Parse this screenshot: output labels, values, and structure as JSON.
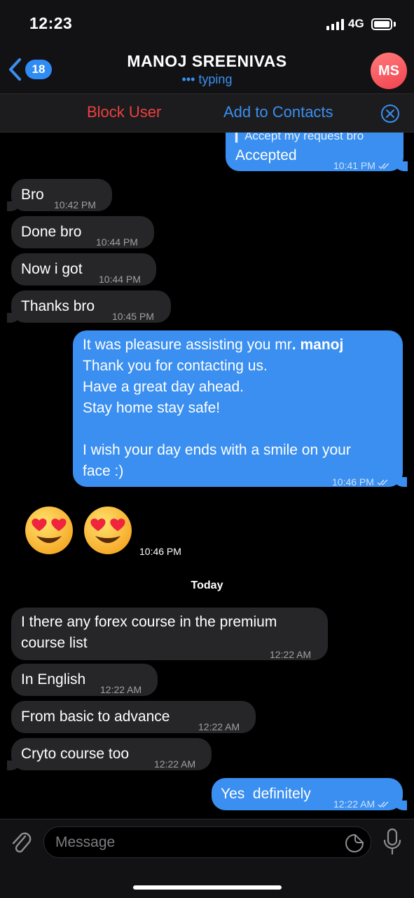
{
  "status_bar": {
    "time": "12:23",
    "network": "4G"
  },
  "header": {
    "back_badge": "18",
    "title": "MANOJ SREENIVAS",
    "status": "••• typing",
    "avatar_initials": "MS"
  },
  "action_bar": {
    "block_label": "Block User",
    "add_label": "Add to Contacts"
  },
  "messages": [
    {
      "dir": "out",
      "reply_preview": "Accept my request bro",
      "text": "Accepted",
      "time": "10:41 PM"
    },
    {
      "dir": "in",
      "text": "Bro",
      "time": "10:42 PM"
    },
    {
      "dir": "in",
      "text": "Done bro",
      "time": "10:44 PM"
    },
    {
      "dir": "in",
      "text": "Now i got",
      "time": "10:44 PM"
    },
    {
      "dir": "in",
      "text": "Thanks bro",
      "time": "10:45 PM"
    },
    {
      "dir": "out",
      "lines": [
        "It was pleasure assisting you mr",
        ". manoj",
        "Thank you for contacting us.",
        "Have a great day ahead.",
        "Stay home stay safe!",
        "I wish your day ends with a smile on your",
        "face :)"
      ],
      "time": "10:46 PM"
    },
    {
      "dir": "in",
      "type": "emoji",
      "emoji_names": [
        "heart-eyes-emoji",
        "heart-eyes-emoji"
      ],
      "time": "10:46 PM"
    },
    {
      "dir": "in",
      "lines": [
        "I there any forex course in the premium",
        "course list"
      ],
      "time": "12:22 AM"
    },
    {
      "dir": "in",
      "text": "In English",
      "time": "12:22 AM"
    },
    {
      "dir": "in",
      "text": "From basic to advance",
      "time": "12:22 AM"
    },
    {
      "dir": "in",
      "text": "Cryto course too",
      "time": "12:22 AM"
    },
    {
      "dir": "out",
      "text": "Yes  definitely",
      "time": "12:22 AM"
    }
  ],
  "date_separator": "Today",
  "composer": {
    "placeholder": "Message"
  },
  "colors": {
    "outgoing": "#3a8ff0",
    "incoming": "#262628",
    "accent": "#3a8ff0",
    "danger": "#ef3f3f",
    "avatar": "#f2434f"
  },
  "icons": {
    "back": "chevron-left-icon",
    "close": "close-circle-icon",
    "attach": "paperclip-icon",
    "sticker": "sticker-icon",
    "mic": "microphone-icon",
    "read": "double-check-icon"
  }
}
